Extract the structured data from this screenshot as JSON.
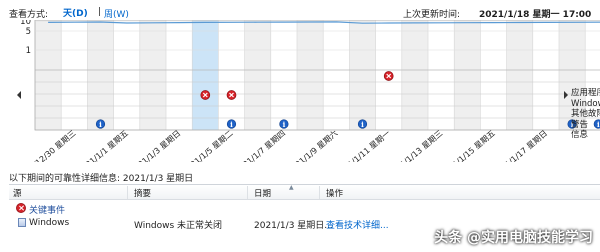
{
  "header": {
    "view_label": "查看方式:",
    "day_view": "天(D)",
    "separator": "|",
    "week_view": "周(W)",
    "last_update_label": "上次更新时间:",
    "last_update_value": "2021/1/18 星期一 17:00"
  },
  "chart": {
    "y_ticks": [
      "10",
      "5",
      "1"
    ],
    "dates": [
      "2020/12/30 星期三",
      "2021/1/1 星期五",
      "2021/1/3 星期日",
      "2021/1/5 星期二",
      "2021/1/7 星期四",
      "2021/1/9 星期六",
      "2021/1/11 星期一",
      "2021/1/13 星期三",
      "2021/1/15 星期五",
      "2021/1/17 星期日"
    ],
    "stability_index": [
      9.3,
      9.4,
      9.5,
      9.0,
      9.1,
      9.2,
      9.3,
      9.35,
      9.4,
      9.45,
      9.5,
      9.55,
      8.9,
      9.0,
      9.05,
      9.1,
      9.15,
      9.2,
      9.25,
      9.3,
      9.35,
      9.4,
      9.45,
      9.5,
      9.55,
      9.6,
      9.65,
      9.7,
      9.75,
      9.8,
      9.85
    ],
    "selected_day": 6,
    "critical_events": [
      {
        "day": 6,
        "row": 1
      },
      {
        "day": 7,
        "row": 1
      },
      {
        "day": 13,
        "row": 0
      }
    ],
    "info_events": [
      {
        "day": 2
      },
      {
        "day": 7
      },
      {
        "day": 9
      },
      {
        "day": 12
      },
      {
        "day": 20
      },
      {
        "day": 21
      }
    ],
    "legend": [
      "应用程序故障",
      "Windows 故障",
      "其他故障",
      "警告",
      "信息"
    ],
    "colors": {
      "selected": "#cce4f7",
      "shade": "#efefef",
      "line": "#5b9bd5",
      "critical": "#d8232a",
      "info": "#1f62c7"
    }
  },
  "details": {
    "period_label": "以下期间的可靠性详细信息: 2021/1/3 星期日",
    "columns": {
      "source": "源",
      "summary": "摘要",
      "date": "日期",
      "action": "操作"
    },
    "group_label": "关键事件",
    "rows": [
      {
        "source": "Windows",
        "summary": "Windows 未正常关闭",
        "date": "2021/1/3 星期日...",
        "action": "查看技术详细..."
      }
    ]
  },
  "watermark": "头条 @实用电脑技能学习"
}
